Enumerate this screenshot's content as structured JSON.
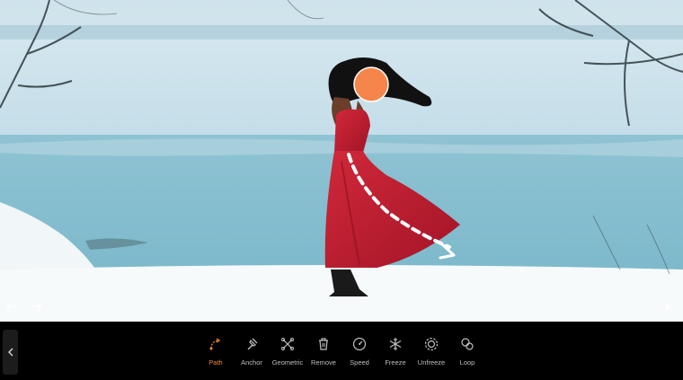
{
  "colors": {
    "accent": "#f08a3c",
    "toolbar_bg": "#000000",
    "icon": "#bfbfbf",
    "label": "#bfbfbf",
    "face_marker": "#f5854a"
  },
  "canvas": {
    "undo_icon": "undo-arrow-icon",
    "redo_icon": "redo-arrow-icon",
    "play_icon": "play-icon",
    "path_marker": "dashed-path-arrow"
  },
  "toolbar": {
    "collapse_icon": "chevron-left-icon",
    "active": "path",
    "tools": [
      {
        "id": "path",
        "label": "Path",
        "icon": "path-icon"
      },
      {
        "id": "anchor",
        "label": "Anchor",
        "icon": "anchor-pin-icon"
      },
      {
        "id": "geometric",
        "label": "Geometric",
        "icon": "geometric-icon"
      },
      {
        "id": "remove",
        "label": "Remove",
        "icon": "trash-icon"
      },
      {
        "id": "speed",
        "label": "Speed",
        "icon": "speedometer-icon"
      },
      {
        "id": "freeze",
        "label": "Freeze",
        "icon": "snowflake-icon"
      },
      {
        "id": "unfreeze",
        "label": "Unfreeze",
        "icon": "sun-icon"
      },
      {
        "id": "loop",
        "label": "Loop",
        "icon": "loop-icon"
      }
    ]
  }
}
